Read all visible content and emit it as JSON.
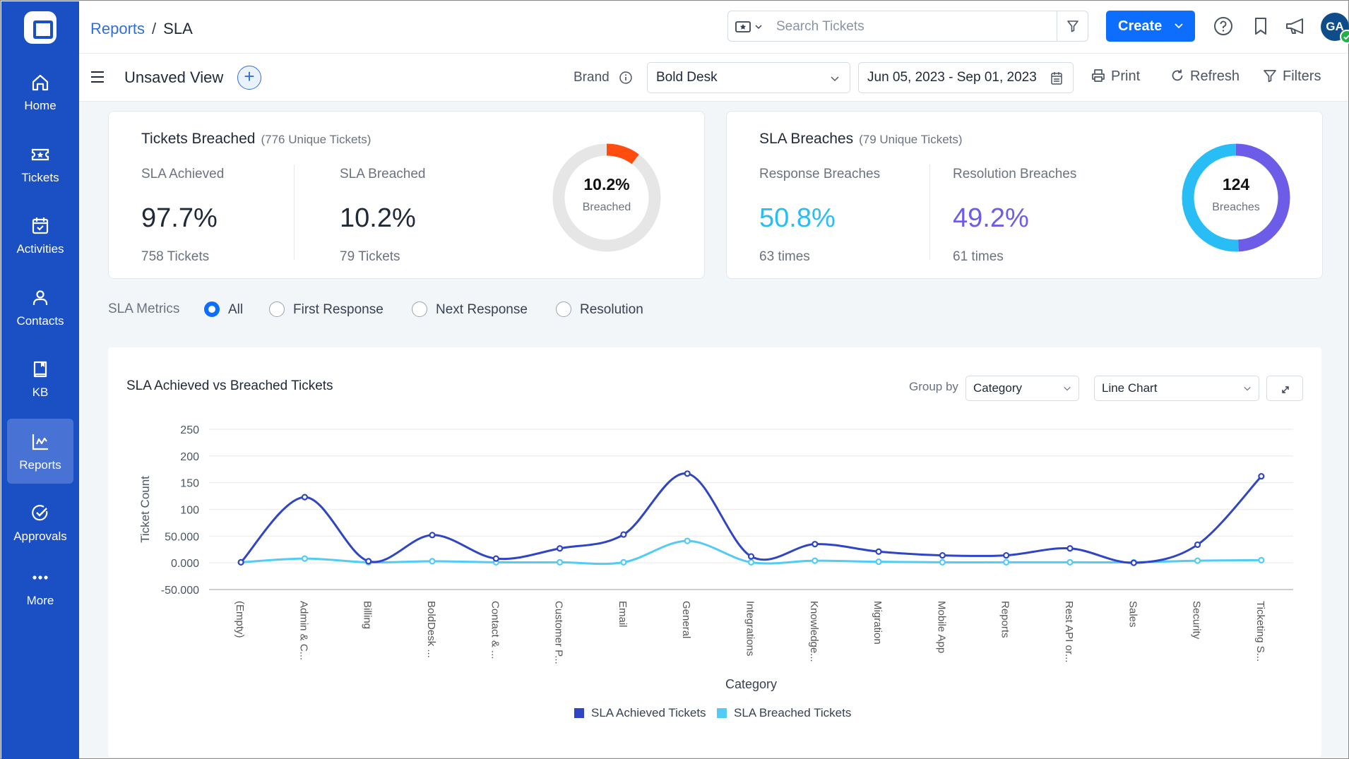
{
  "sidebar": {
    "items": [
      {
        "label": "Home",
        "icon": "home-icon"
      },
      {
        "label": "Tickets",
        "icon": "ticket-icon"
      },
      {
        "label": "Activities",
        "icon": "calendar-icon"
      },
      {
        "label": "Contacts",
        "icon": "user-icon"
      },
      {
        "label": "KB",
        "icon": "book-icon"
      },
      {
        "label": "Reports",
        "icon": "chart-icon",
        "active": true
      },
      {
        "label": "Approvals",
        "icon": "check-circle-icon"
      },
      {
        "label": "More",
        "icon": "more-icon"
      }
    ]
  },
  "header": {
    "breadcrumb_parent": "Reports",
    "breadcrumb_sep": "/",
    "breadcrumb_current": "SLA",
    "search_placeholder": "Search Tickets",
    "create_label": "Create",
    "avatar_initials": "GA"
  },
  "toolbar": {
    "view_name": "Unsaved View",
    "brand_label": "Brand",
    "brand_value": "Bold Desk",
    "date_range": "Jun 05, 2023 - Sep 01, 2023",
    "print_label": "Print",
    "refresh_label": "Refresh",
    "filters_label": "Filters"
  },
  "tickets_card": {
    "title": "Tickets Breached",
    "subtitle": "(776 Unique Tickets)",
    "achieved_label": "SLA Achieved",
    "achieved_value": "97.7%",
    "achieved_count": "758 Tickets",
    "breached_label": "SLA Breached",
    "breached_value": "10.2%",
    "breached_count": "79 Tickets",
    "donut_value": "10.2%",
    "donut_label": "Breached",
    "donut_fraction": 0.102,
    "colors": {
      "breach": "#ff4d0f",
      "track": "#e6e6e6"
    }
  },
  "breaches_card": {
    "title": "SLA Breaches",
    "subtitle": "(79 Unique Tickets)",
    "response_label": "Response Breaches",
    "response_value": "50.8%",
    "response_count": "63 times",
    "resolution_label": "Resolution Breaches",
    "resolution_value": "49.2%",
    "resolution_count": "61 times",
    "donut_value": "124",
    "donut_label": "Breaches",
    "response_fraction": 0.508,
    "colors": {
      "response": "#29bdf5",
      "resolution": "#6c5ce7"
    }
  },
  "metrics": {
    "label": "SLA Metrics",
    "options": [
      {
        "label": "All",
        "selected": true
      },
      {
        "label": "First Response",
        "selected": false
      },
      {
        "label": "Next Response",
        "selected": false
      },
      {
        "label": "Resolution",
        "selected": false
      }
    ]
  },
  "chart_panel": {
    "title": "SLA Achieved vs Breached Tickets",
    "group_by_label": "Group by",
    "group_by_value": "Category",
    "chart_type_value": "Line Chart"
  },
  "chart_data": {
    "type": "line",
    "title": "SLA Achieved vs Breached Tickets",
    "xlabel": "Category",
    "ylabel": "Ticket Count",
    "ylim": [
      -50,
      250
    ],
    "yticks": [
      {
        "v": 250,
        "label": "250"
      },
      {
        "v": 200,
        "label": "200"
      },
      {
        "v": 150,
        "label": "150"
      },
      {
        "v": 100,
        "label": "100"
      },
      {
        "v": 50,
        "label": "50.000"
      },
      {
        "v": 0,
        "label": "0.000"
      },
      {
        "v": -50,
        "label": "-50.000"
      }
    ],
    "grid": true,
    "legend": "bottom",
    "categories": [
      "(Empty)",
      "Admin & C...",
      "Billing",
      "BoldDesk ...",
      "Contact & ...",
      "Customer P...",
      "Email",
      "General",
      "Integrations",
      "Knowledge...",
      "Migration",
      "Mobile App",
      "Reports",
      "Rest API or...",
      "Sales",
      "Security",
      "Ticketing S..."
    ],
    "series": [
      {
        "name": "SLA Achieved Tickets",
        "color": "#2f45c5",
        "values": [
          1,
          123,
          3,
          52,
          8,
          27,
          53,
          167,
          12,
          35,
          21,
          14,
          14,
          27,
          0,
          34,
          162
        ]
      },
      {
        "name": "SLA Breached Tickets",
        "color": "#52cbf5",
        "values": [
          1,
          8,
          1,
          3,
          1,
          1,
          1,
          41,
          1,
          4,
          2,
          1,
          1,
          1,
          1,
          4,
          5
        ]
      }
    ]
  }
}
